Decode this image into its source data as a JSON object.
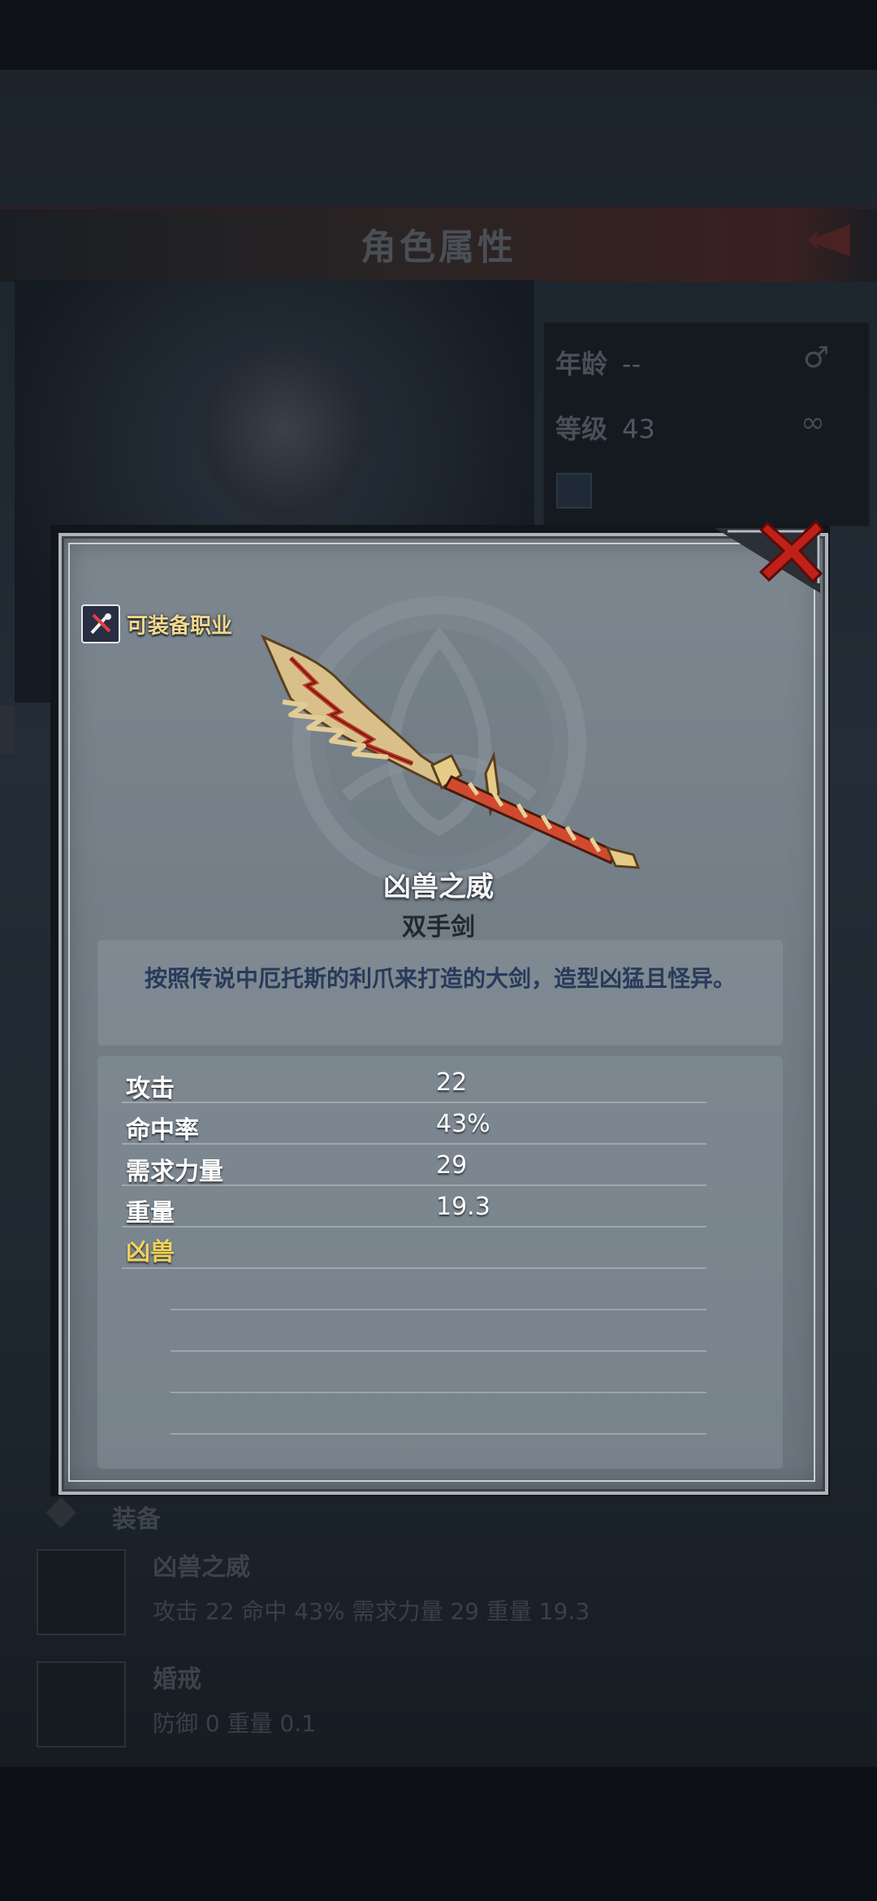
{
  "background": {
    "screen_title": "角色属性",
    "stats": [
      {
        "label": "年龄",
        "value": "--"
      },
      {
        "label": "等级",
        "value": "43"
      }
    ],
    "equip_section_label": "装备",
    "equipped_items": [
      {
        "name": "凶兽之威",
        "stats": "攻击 22  命中 43%  需求力量 29  重量 19.3"
      },
      {
        "name": "婚戒",
        "stats": "防御 0  重量 0.1"
      }
    ]
  },
  "modal": {
    "job_label": "可装备职业",
    "item_name": "凶兽之威",
    "item_type": "双手剑",
    "description": "按照传说中厄托斯的利爪来打造的大剑，造型凶猛且怪异。",
    "stats": [
      {
        "label": "攻击",
        "value": "22"
      },
      {
        "label": "命中率",
        "value": "43%"
      },
      {
        "label": "需求力量",
        "value": "29"
      },
      {
        "label": "重量",
        "value": "19.3"
      }
    ],
    "tag": "凶兽"
  },
  "colors": {
    "accent_red": "#c0201a",
    "tag_gold": "#f2d25a",
    "job_label_gold": "#f0d890"
  },
  "icons": [
    "close-icon",
    "job-class-icon",
    "weapon-image",
    "back-arrow-icon",
    "gender-icon",
    "bond-icon"
  ]
}
